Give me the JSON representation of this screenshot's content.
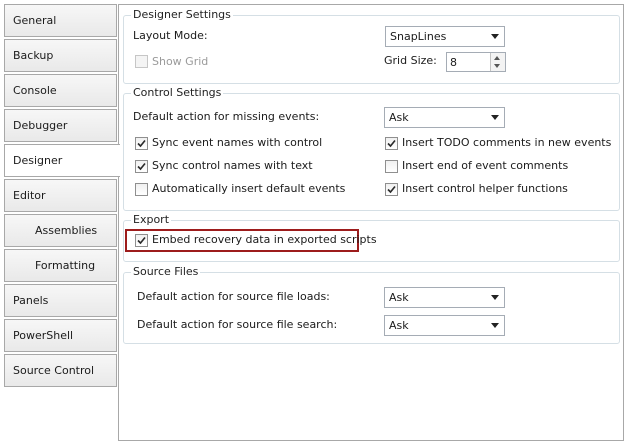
{
  "tabs": [
    {
      "label": "General"
    },
    {
      "label": "Backup"
    },
    {
      "label": "Console"
    },
    {
      "label": "Debugger"
    },
    {
      "label": "Designer"
    },
    {
      "label": "Editor"
    },
    {
      "label": "Assemblies"
    },
    {
      "label": "Formatting"
    },
    {
      "label": "Panels"
    },
    {
      "label": "PowerShell"
    },
    {
      "label": "Source Control"
    }
  ],
  "designer_settings": {
    "title": "Designer Settings",
    "layout_mode_label": "Layout Mode:",
    "layout_mode_value": "SnapLines",
    "show_grid_label": "Show Grid",
    "show_grid_checked": false,
    "grid_size_label": "Grid Size:",
    "grid_size_value": "8"
  },
  "control_settings": {
    "title": "Control Settings",
    "missing_events_label": "Default action for missing events:",
    "missing_events_value": "Ask",
    "sync_event_names": {
      "label": "Sync event names with control",
      "checked": true
    },
    "sync_control_names": {
      "label": "Sync control names with text",
      "checked": true
    },
    "auto_insert_events": {
      "label": "Automatically insert default events",
      "checked": false
    },
    "insert_todo": {
      "label": "Insert TODO comments in new events",
      "checked": true
    },
    "insert_end_comments": {
      "label": "Insert end of event comments",
      "checked": false
    },
    "insert_helper": {
      "label": "Insert control helper functions",
      "checked": true
    }
  },
  "export": {
    "title": "Export",
    "embed_recovery": {
      "label": "Embed recovery data in exported scripts",
      "checked": true
    }
  },
  "source_files": {
    "title": "Source Files",
    "loads_label": "Default action for source file loads:",
    "loads_value": "Ask",
    "search_label": "Default action for source file search:",
    "search_value": "Ask"
  },
  "colors": {
    "highlight_border": "#9d1c1c",
    "group_border": "#d5dfe5"
  }
}
